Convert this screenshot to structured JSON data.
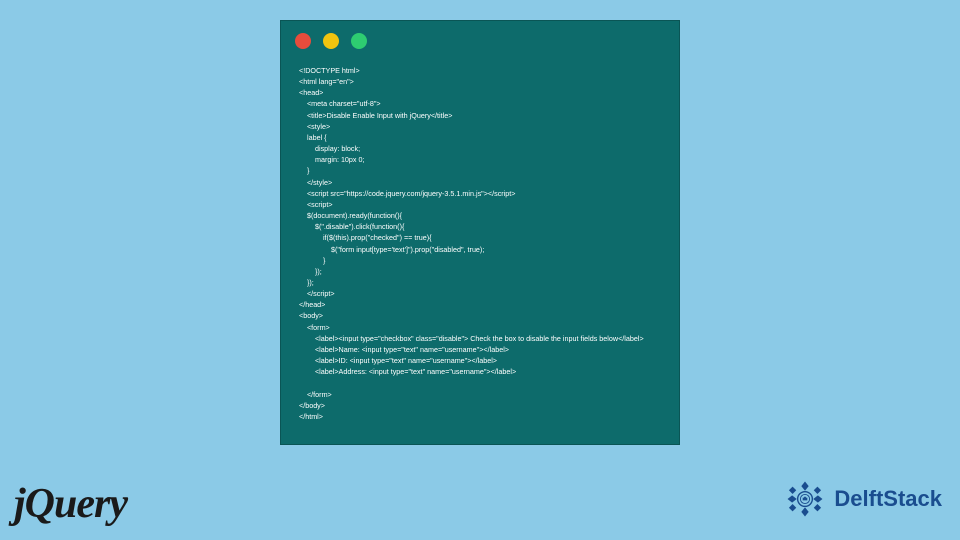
{
  "code_window": {
    "lines": [
      "<!DOCTYPE html>",
      "<html lang=\"en\">",
      "<head>",
      "    <meta charset=\"utf-8\">",
      "    <title>Disable Enable Input with jQuery</title>",
      "    <style>",
      "    label {",
      "        display: block;",
      "        margin: 10px 0;",
      "    }",
      "    </style>",
      "    <script src=\"https://code.jquery.com/jquery-3.5.1.min.js\"></script>",
      "    <script>",
      "    $(document).ready(function(){",
      "        $(\".disable\").click(function(){",
      "            if($(this).prop(\"checked\") == true){",
      "                $(\"form input[type='text']\").prop(\"disabled\", true);",
      "            }",
      "        });",
      "    });",
      "    </script>",
      "</head>",
      "<body>",
      "    <form>",
      "        <label><input type=\"checkbox\" class=\"disable\"> Check the box to disable the input fields below</label>",
      "        <label>Name: <input type=\"text\" name=\"username\"></label>",
      "        <label>ID: <input type=\"text\" name=\"username\"></label>",
      "        <label>Address: <input type=\"text\" name=\"username\"></label>",
      "",
      "    </form>",
      "</body>",
      "</html>"
    ]
  },
  "logos": {
    "jquery": "jQuery",
    "delft": "DelftStack"
  }
}
